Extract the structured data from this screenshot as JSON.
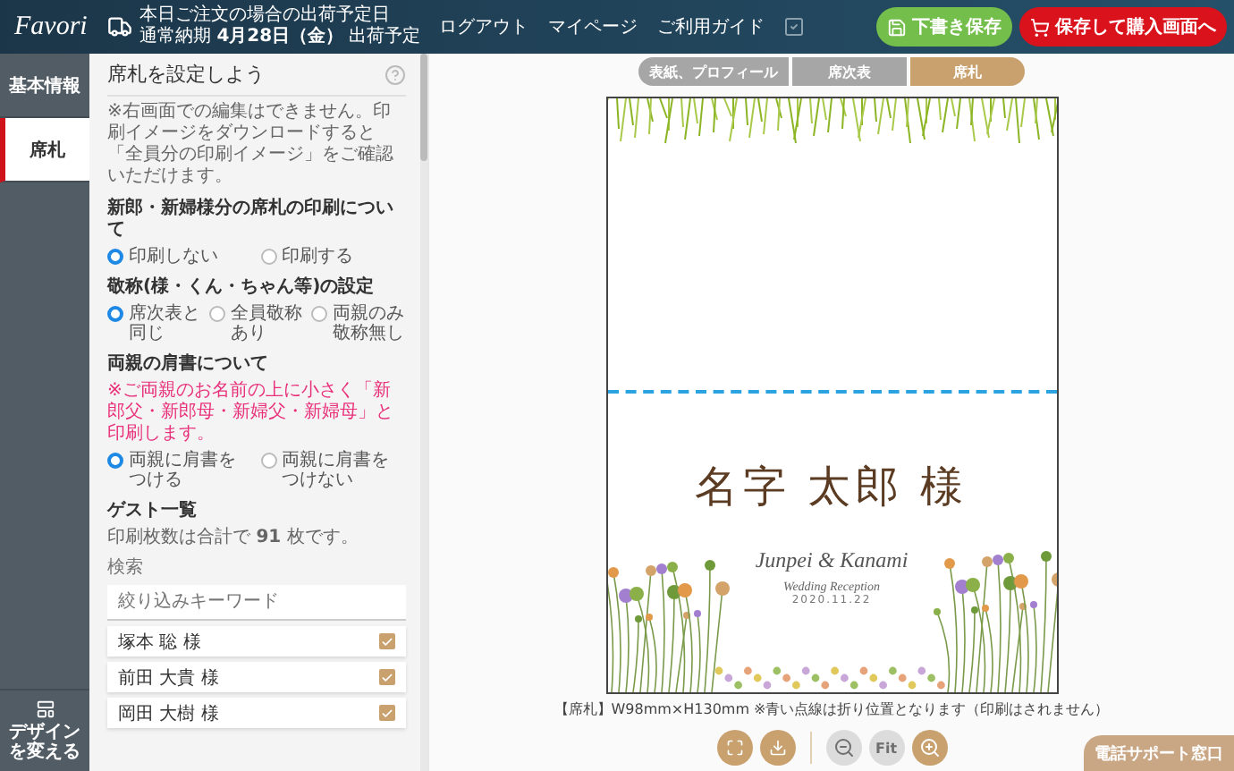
{
  "header": {
    "logo": "Favori",
    "shipping_line_1": "本日ご注文の場合の出荷予定日",
    "shipping_line_2": "通常納期 **4月28日（金）** 出荷予定",
    "nav": [
      "ログアウト",
      "マイページ",
      "ご利用ガイド"
    ],
    "buttons": [
      {
        "kind": "draft",
        "label": "下書き保存"
      },
      {
        "kind": "purchase",
        "label": "保存して購入画面へ"
      }
    ]
  },
  "sidebar": {
    "items": [
      {
        "label": "基本情報",
        "selected": false
      },
      {
        "label": "席札",
        "selected": true
      }
    ],
    "change_design": "デザインを変える"
  },
  "panel": {
    "title": "席札を設定しよう",
    "intro": "※右画面での編集はできません。印刷イメージをダウンロードすると「全員分の印刷イメージ」をご確認いただけます。",
    "sections": [
      {
        "title": "新郎・新婦様分の席札の印刷について",
        "options": [
          {
            "label": "印刷しない",
            "selected": true
          },
          {
            "label": "印刷する",
            "selected": false
          }
        ]
      },
      {
        "title": "敬称(様・くん・ちゃん等)の設定",
        "options": [
          {
            "label": "席次表と同じ",
            "selected": true
          },
          {
            "label": "全員敬称あり",
            "selected": false
          },
          {
            "label": "両親のみ敬称無し",
            "selected": false
          }
        ]
      },
      {
        "title": "両親の肩書について",
        "note": "※ご両親のお名前の上に小さく「新郎父・新郎母・新婦父・新婦母」と印刷します。",
        "options": [
          {
            "label": "両親に肩書をつける",
            "selected": true
          },
          {
            "label": "両親に肩書をつけない",
            "selected": false
          }
        ]
      }
    ],
    "guests": {
      "title": "ゲスト一覧",
      "count_text": "印刷枚数は合計で **91** 枚です。",
      "search_label": "検索",
      "search_placeholder": "絞り込みキーワード",
      "items": [
        {
          "name": "塚本 聡 様",
          "checked": true
        },
        {
          "name": "前田 大貴 様",
          "checked": true
        },
        {
          "name": "岡田 大樹 様",
          "checked": true
        }
      ]
    }
  },
  "preview": {
    "tabs": [
      {
        "label": "表紙、プロフィール",
        "selected": false
      },
      {
        "label": "席次表",
        "selected": false
      },
      {
        "label": "席札",
        "selected": true
      }
    ],
    "card": {
      "name": "名字 太郎 様",
      "couple": "Junpei & Kanami",
      "event": "Wedding Reception",
      "date": "2020.11.22"
    },
    "caption": "【席札】W98mm×H130mm ※青い点線は折り位置となります（印刷はされません）",
    "tool_groups": [
      [
        {
          "kind": "fullscreen",
          "disabled": false
        },
        {
          "kind": "download",
          "disabled": false
        }
      ],
      [
        {
          "kind": "zoom-out",
          "disabled": true
        },
        {
          "kind": "fit",
          "label": "Fit",
          "disabled": true
        },
        {
          "kind": "zoom-in",
          "disabled": false
        }
      ]
    ]
  },
  "support": "電話サポート窓口"
}
